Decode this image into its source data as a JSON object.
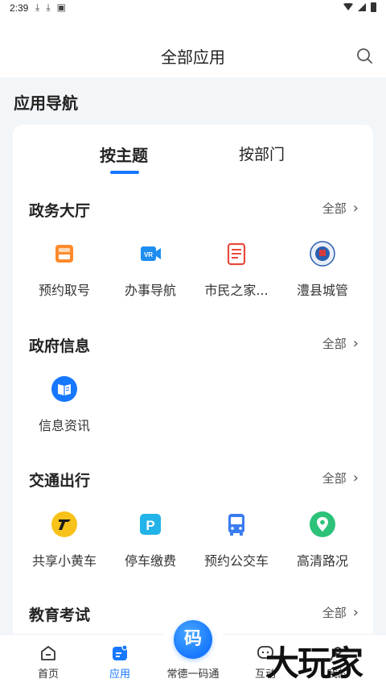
{
  "status_bar": {
    "time": "2:39",
    "left_icons": [
      "download-icon",
      "download-icon",
      "photo-icon"
    ],
    "right_icons": [
      "wifi-icon",
      "signal-icon",
      "battery-icon"
    ]
  },
  "header": {
    "title": "全部应用",
    "search_icon": "search-icon"
  },
  "section": {
    "title": "应用导航"
  },
  "tabs": [
    {
      "label": "按主题",
      "active": true
    },
    {
      "label": "按部门",
      "active": false
    }
  ],
  "groups": [
    {
      "title": "政务大厅",
      "more_label": "全部",
      "apps": [
        {
          "label": "预约取号",
          "icon": "ticket-icon",
          "color": "#ff8a2b"
        },
        {
          "label": "办事导航",
          "icon": "vr-camera-icon",
          "color": "#1e8df0"
        },
        {
          "label": "市民之家...",
          "icon": "document-icon",
          "color": "#e84a3c"
        },
        {
          "label": "澧县城管",
          "icon": "emblem-icon",
          "color": "#2a5fb0"
        }
      ]
    },
    {
      "title": "政府信息",
      "more_label": "全部",
      "apps": [
        {
          "label": "信息资讯",
          "icon": "book-icon",
          "color": "#1677ff"
        }
      ]
    },
    {
      "title": "交通出行",
      "more_label": "全部",
      "apps": [
        {
          "label": "共享小黄车",
          "icon": "bike-share-icon",
          "color": "#f7c21a"
        },
        {
          "label": "停车缴费",
          "icon": "parking-icon",
          "color": "#22b4e8"
        },
        {
          "label": "预约公交车",
          "icon": "bus-icon",
          "color": "#3a7cf0"
        },
        {
          "label": "高清路况",
          "icon": "map-pin-icon",
          "color": "#2cc27a"
        }
      ]
    },
    {
      "title": "教育考试",
      "more_label": "全部",
      "apps": []
    }
  ],
  "bottom_nav": {
    "items": [
      {
        "label": "首页",
        "icon": "home-icon",
        "active": false
      },
      {
        "label": "应用",
        "icon": "apps-icon",
        "active": true
      },
      {
        "label": "常德一码通",
        "icon": "qr-code-icon",
        "active": false
      },
      {
        "label": "互动",
        "icon": "chat-icon",
        "active": false
      },
      {
        "label": "我的",
        "icon": "user-icon",
        "active": false
      }
    ],
    "center_glyph": "码"
  },
  "watermark": "大玩家",
  "colors": {
    "accent": "#1677ff",
    "background": "#f3f6f9"
  }
}
